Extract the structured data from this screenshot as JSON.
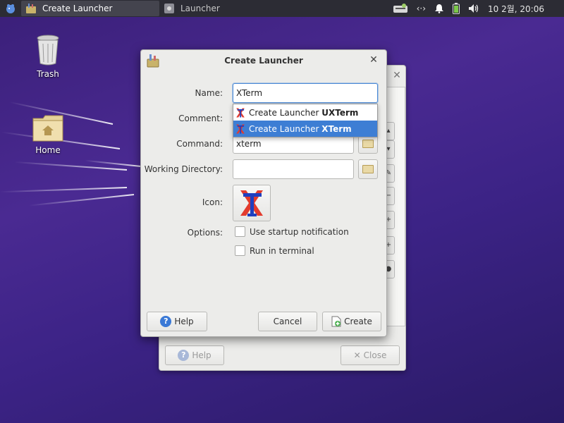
{
  "taskbar": {
    "tasks": [
      {
        "label": "Create Launcher",
        "active": true
      },
      {
        "label": "Launcher",
        "active": false
      }
    ],
    "clock": "10 2월, 20:06",
    "network_label": "‹·›"
  },
  "desktop": {
    "icons": [
      {
        "label": "Trash",
        "icon": "trash-icon"
      },
      {
        "label": "Home",
        "icon": "home-folder-icon"
      }
    ]
  },
  "back_dialog": {
    "help_label": "Help",
    "close_label": "Close",
    "close_glyph": "✕"
  },
  "dialog": {
    "title": "Create Launcher",
    "close_glyph": "✕",
    "labels": {
      "name": "Name:",
      "comment": "Comment:",
      "command": "Command:",
      "working_directory": "Working Directory:",
      "icon": "Icon:",
      "options": "Options:"
    },
    "fields": {
      "name_value": "XTerm",
      "comment_value": "",
      "command_value": "xterm",
      "working_directory_value": ""
    },
    "options": [
      {
        "label": "Use startup notification",
        "checked": false
      },
      {
        "label": "Run in terminal",
        "checked": false
      }
    ],
    "buttons": {
      "help": "Help",
      "cancel": "Cancel",
      "create": "Create"
    },
    "autocomplete": [
      {
        "prefix": "Create Launcher ",
        "bold": "UXTerm",
        "selected": false
      },
      {
        "prefix": "Create Launcher ",
        "bold": "XTerm",
        "selected": true
      }
    ]
  },
  "colors": {
    "selection": "#3d7ed4",
    "panel_bg": "#2c2c34",
    "focus_border": "#4b8ad6"
  }
}
